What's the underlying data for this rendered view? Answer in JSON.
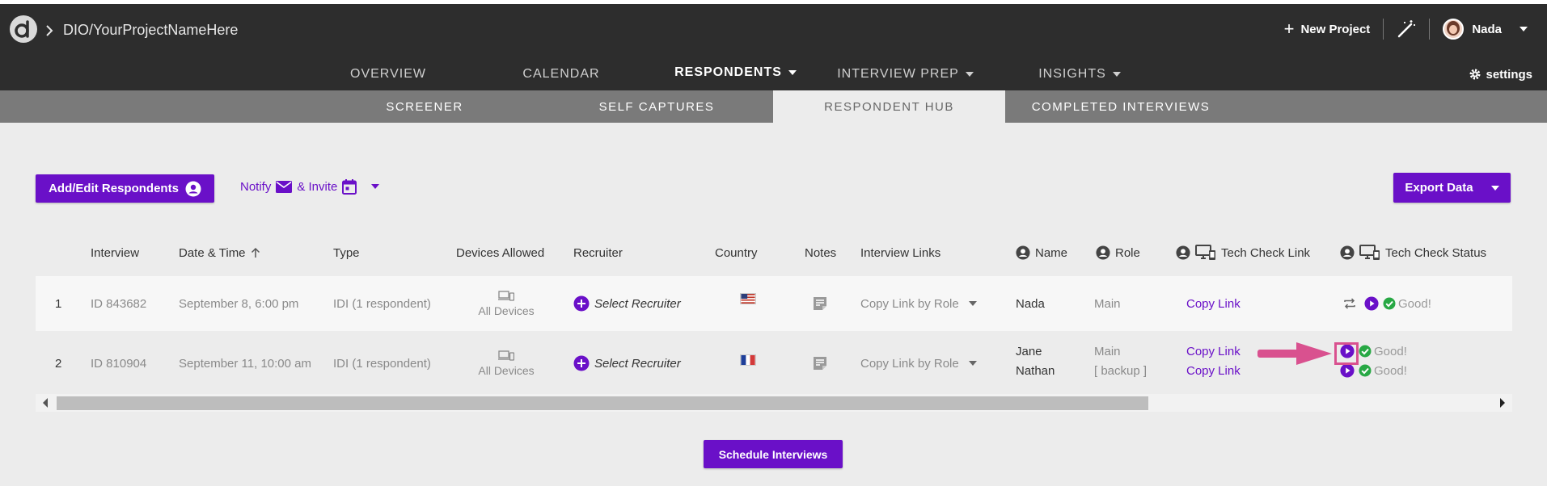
{
  "header": {
    "project_name": "DIO/YourProjectNameHere",
    "new_project_label": "New Project",
    "user_name": "Nada",
    "settings_label": "settings"
  },
  "main_nav": [
    {
      "label": "OVERVIEW"
    },
    {
      "label": "CALENDAR"
    },
    {
      "label": "RESPONDENTS"
    },
    {
      "label": "INTERVIEW PREP"
    },
    {
      "label": "INSIGHTS"
    }
  ],
  "sub_nav": [
    {
      "label": "SCREENER"
    },
    {
      "label": "SELF CAPTURES"
    },
    {
      "label": "RESPONDENT HUB"
    },
    {
      "label": "COMPLETED INTERVIEWS"
    }
  ],
  "toolbar": {
    "add_edit_label": "Add/Edit Respondents",
    "notify_label": "Notify",
    "invite_label": "& Invite",
    "export_label": "Export Data",
    "schedule_label": "Schedule Interviews"
  },
  "table": {
    "columns": {
      "interview": "Interview",
      "datetime": "Date & Time",
      "type": "Type",
      "devices": "Devices Allowed",
      "recruiter": "Recruiter",
      "country": "Country",
      "notes": "Notes",
      "links": "Interview Links",
      "name": "Name",
      "role": "Role",
      "tech_link": "Tech Check Link",
      "tech_status": "Tech Check Status"
    },
    "rows": [
      {
        "index": "1",
        "interview": "ID 843682",
        "datetime": "September 8, 6:00 pm",
        "type": "IDI (1 respondent)",
        "devices": "All Devices",
        "recruiter": "Select Recruiter",
        "links": "Copy Link by Role",
        "names": [
          "Nada"
        ],
        "roles": [
          "Main"
        ],
        "tech_links": [
          "Copy Link"
        ],
        "tech_status": [
          "Good!"
        ]
      },
      {
        "index": "2",
        "interview": "ID 810904",
        "datetime": "September 11, 10:00 am",
        "type": "IDI (1 respondent)",
        "devices": "All Devices",
        "recruiter": "Select Recruiter",
        "links": "Copy Link by Role",
        "names": [
          "Jane",
          "Nathan"
        ],
        "roles": [
          "Main",
          "[ backup ]"
        ],
        "tech_links": [
          "Copy Link",
          "Copy Link"
        ],
        "tech_status": [
          "Good!",
          "Good!"
        ]
      }
    ]
  },
  "colors": {
    "accent_purple": "#6a10c8",
    "accent_pink": "#d9518f",
    "good_green": "#27a844",
    "topbar_bg": "#2d2d2d"
  }
}
